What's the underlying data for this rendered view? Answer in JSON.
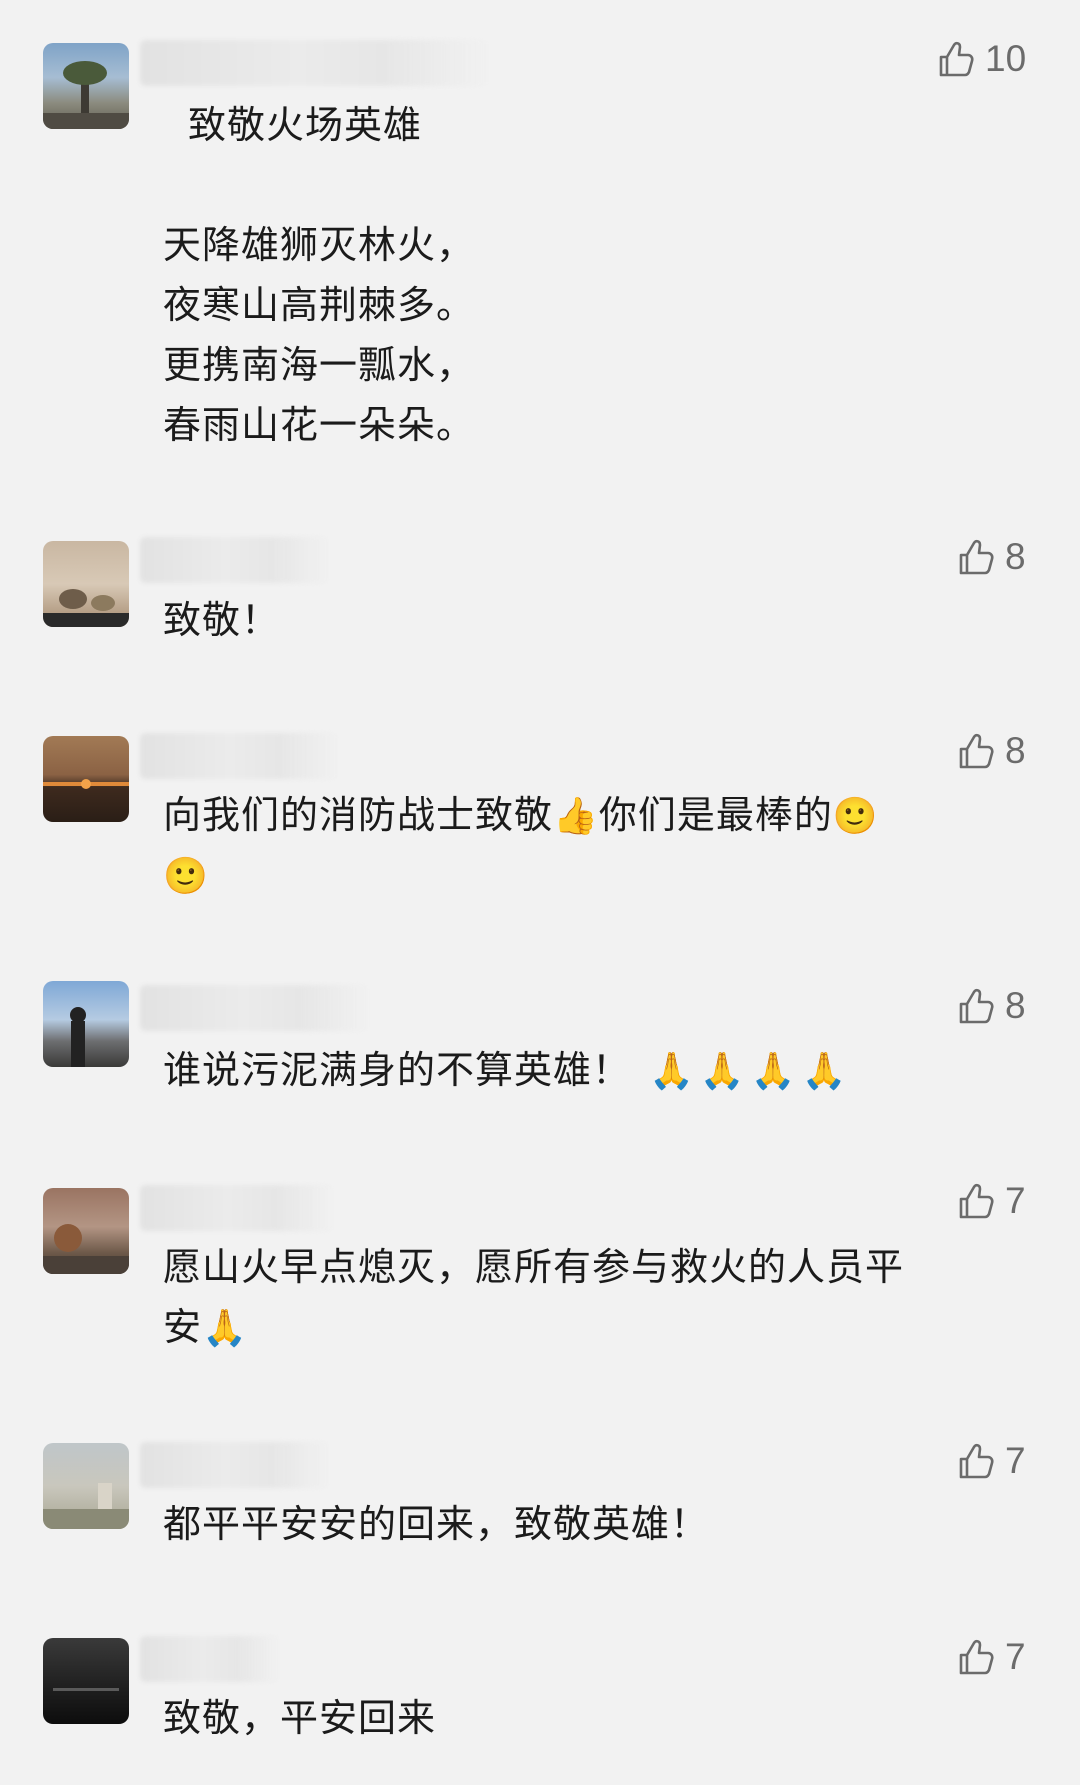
{
  "comments": [
    {
      "likes": "10",
      "title": "致敬火场英雄",
      "lines": [
        "天降雄狮灭林火，",
        "夜寒山高荆棘多。",
        "更携南海一瓢水，",
        "春雨山花一朵朵。"
      ]
    },
    {
      "likes": "8",
      "text": "致敬！"
    },
    {
      "likes": "8",
      "text_a": "向我们的消防战士致敬",
      "emoji_a": "👍",
      "text_b": "你们是最棒的",
      "emoji_b": "🙂",
      "emoji_c": "🙂"
    },
    {
      "likes": "8",
      "text": "谁说污泥满身的不算英雄！",
      "emojis": "🙏🙏🙏🙏"
    },
    {
      "likes": "7",
      "text_line1": "愿山火早点熄灭，愿所有参与救火的人员平",
      "text_line2": "安",
      "emoji": "🙏"
    },
    {
      "likes": "7",
      "text": "都平平安安的回来，致敬英雄！"
    },
    {
      "likes": "7",
      "text": "致敬，平安回来"
    }
  ],
  "colors": {
    "background": "#f2f2f2",
    "text": "#1b1b1b",
    "like": "#6b6b6b"
  },
  "icons": {
    "like": "thumbs-up-outline-icon"
  }
}
